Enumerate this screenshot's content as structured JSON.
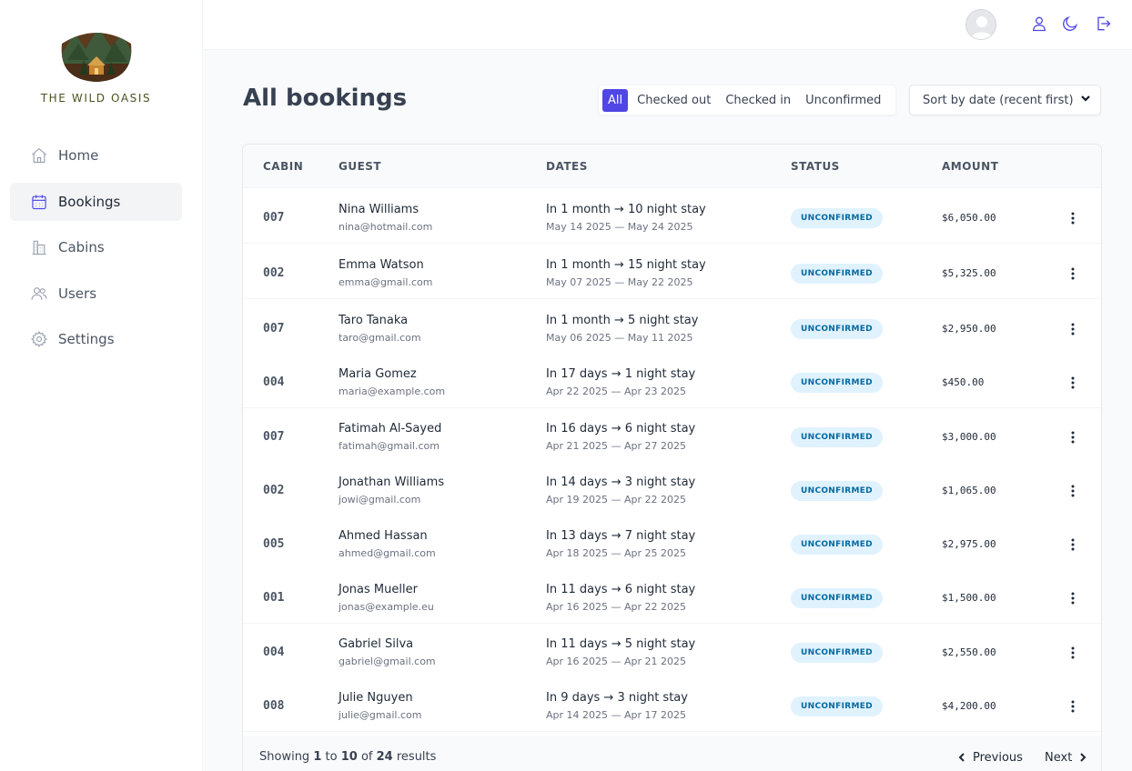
{
  "app": {
    "name": "THE WILD OASIS"
  },
  "sidebar": {
    "items": [
      {
        "label": "Home",
        "icon": "home-icon"
      },
      {
        "label": "Bookings",
        "icon": "calendar-icon",
        "active": true
      },
      {
        "label": "Cabins",
        "icon": "building-icon"
      },
      {
        "label": "Users",
        "icon": "users-icon"
      },
      {
        "label": "Settings",
        "icon": "gear-icon"
      }
    ]
  },
  "header": {
    "icons": [
      "user-icon",
      "moon-icon",
      "logout-icon"
    ]
  },
  "main": {
    "title": "All bookings",
    "filter": {
      "options": [
        "All",
        "Checked out",
        "Checked in",
        "Unconfirmed"
      ],
      "active": "All"
    },
    "sort": {
      "selected": "Sort by date (recent first)"
    },
    "table": {
      "columns": [
        "CABIN",
        "GUEST",
        "DATES",
        "STATUS",
        "AMOUNT"
      ],
      "rows": [
        {
          "cabin": "007",
          "guest": "Nina Williams",
          "email": "nina@hotmail.com",
          "when": "In 1 month → 10 night stay",
          "range": "May 14 2025 — May 24 2025",
          "status": "UNCONFIRMED",
          "amount": "$6,050.00"
        },
        {
          "cabin": "002",
          "guest": "Emma Watson",
          "email": "emma@gmail.com",
          "when": "In 1 month → 15 night stay",
          "range": "May 07 2025 — May 22 2025",
          "status": "UNCONFIRMED",
          "amount": "$5,325.00"
        },
        {
          "cabin": "007",
          "guest": "Taro Tanaka",
          "email": "taro@gmail.com",
          "when": "In 1 month → 5 night stay",
          "range": "May 06 2025 — May 11 2025",
          "status": "UNCONFIRMED",
          "amount": "$2,950.00"
        },
        {
          "cabin": "004",
          "guest": "Maria Gomez",
          "email": "maria@example.com",
          "when": "In 17 days → 1 night stay",
          "range": "Apr 22 2025 — Apr 23 2025",
          "status": "UNCONFIRMED",
          "amount": "$450.00"
        },
        {
          "cabin": "007",
          "guest": "Fatimah Al-Sayed",
          "email": "fatimah@gmail.com",
          "when": "In 16 days → 6 night stay",
          "range": "Apr 21 2025 — Apr 27 2025",
          "status": "UNCONFIRMED",
          "amount": "$3,000.00"
        },
        {
          "cabin": "002",
          "guest": "Jonathan Williams",
          "email": "jowi@gmail.com",
          "when": "In 14 days → 3 night stay",
          "range": "Apr 19 2025 — Apr 22 2025",
          "status": "UNCONFIRMED",
          "amount": "$1,065.00"
        },
        {
          "cabin": "005",
          "guest": "Ahmed Hassan",
          "email": "ahmed@gmail.com",
          "when": "In 13 days → 7 night stay",
          "range": "Apr 18 2025 — Apr 25 2025",
          "status": "UNCONFIRMED",
          "amount": "$2,975.00"
        },
        {
          "cabin": "001",
          "guest": "Jonas Mueller",
          "email": "jonas@example.eu",
          "when": "In 11 days → 6 night stay",
          "range": "Apr 16 2025 — Apr 22 2025",
          "status": "UNCONFIRMED",
          "amount": "$1,500.00"
        },
        {
          "cabin": "004",
          "guest": "Gabriel Silva",
          "email": "gabriel@gmail.com",
          "when": "In 11 days → 5 night stay",
          "range": "Apr 16 2025 — Apr 21 2025",
          "status": "UNCONFIRMED",
          "amount": "$2,550.00"
        },
        {
          "cabin": "008",
          "guest": "Julie Nguyen",
          "email": "julie@gmail.com",
          "when": "In 9 days → 3 night stay",
          "range": "Apr 14 2025 — Apr 17 2025",
          "status": "UNCONFIRMED",
          "amount": "$4,200.00"
        }
      ]
    },
    "pagination": {
      "prefix": "Showing",
      "from": "1",
      "to_word": "to",
      "to": "10",
      "of_word": "of",
      "total": "24",
      "suffix": "results",
      "prev_label": "Previous",
      "next_label": "Next"
    }
  },
  "colors": {
    "accent": "#4f46e5",
    "status_bg": "#e0f2fe",
    "status_text": "#0369a1"
  }
}
